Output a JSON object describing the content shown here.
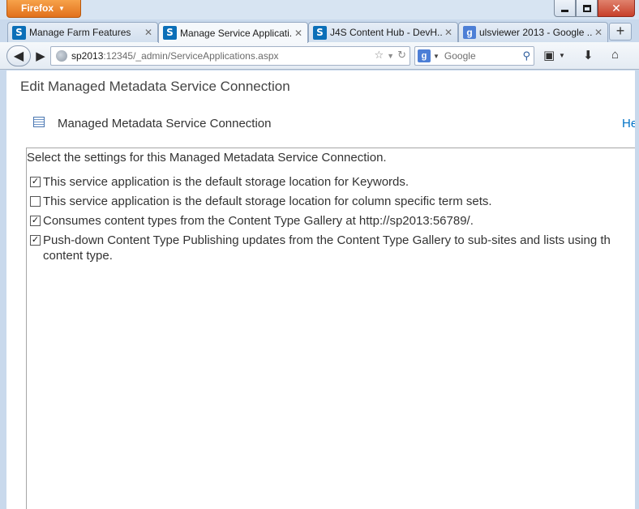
{
  "browser": {
    "app_button": "Firefox",
    "tabs": [
      {
        "label": "Manage Farm Features",
        "icon": "sharepoint-icon",
        "active": false
      },
      {
        "label": "Manage Service Applicati...",
        "icon": "sharepoint-icon",
        "active": true
      },
      {
        "label": "J4S Content Hub - DevH...",
        "icon": "sharepoint-icon",
        "active": false
      },
      {
        "label": "ulsviewer 2013 - Google ...",
        "icon": "google-icon",
        "active": false
      }
    ],
    "url_host": "sp2013",
    "url_rest": ":12345/_admin/ServiceApplications.aspx",
    "search_placeholder": "Google"
  },
  "page": {
    "title": "Edit Managed Metadata Service Connection",
    "dialog_title": "Managed Metadata Service Connection",
    "help_link": "He",
    "intro": "Select the settings for this Managed Metadata Service Connection.",
    "options": [
      {
        "label": "This service application is the default storage location for Keywords.",
        "checked": true
      },
      {
        "label": "This service application is the default storage location for column specific term sets.",
        "checked": false
      },
      {
        "label": "Consumes content types from the Content Type Gallery at http://sp2013:56789/.",
        "checked": true
      },
      {
        "label": "Push-down Content Type Publishing updates from the Content Type Gallery to sub-sites and lists using th content type.",
        "checked": true
      }
    ]
  }
}
